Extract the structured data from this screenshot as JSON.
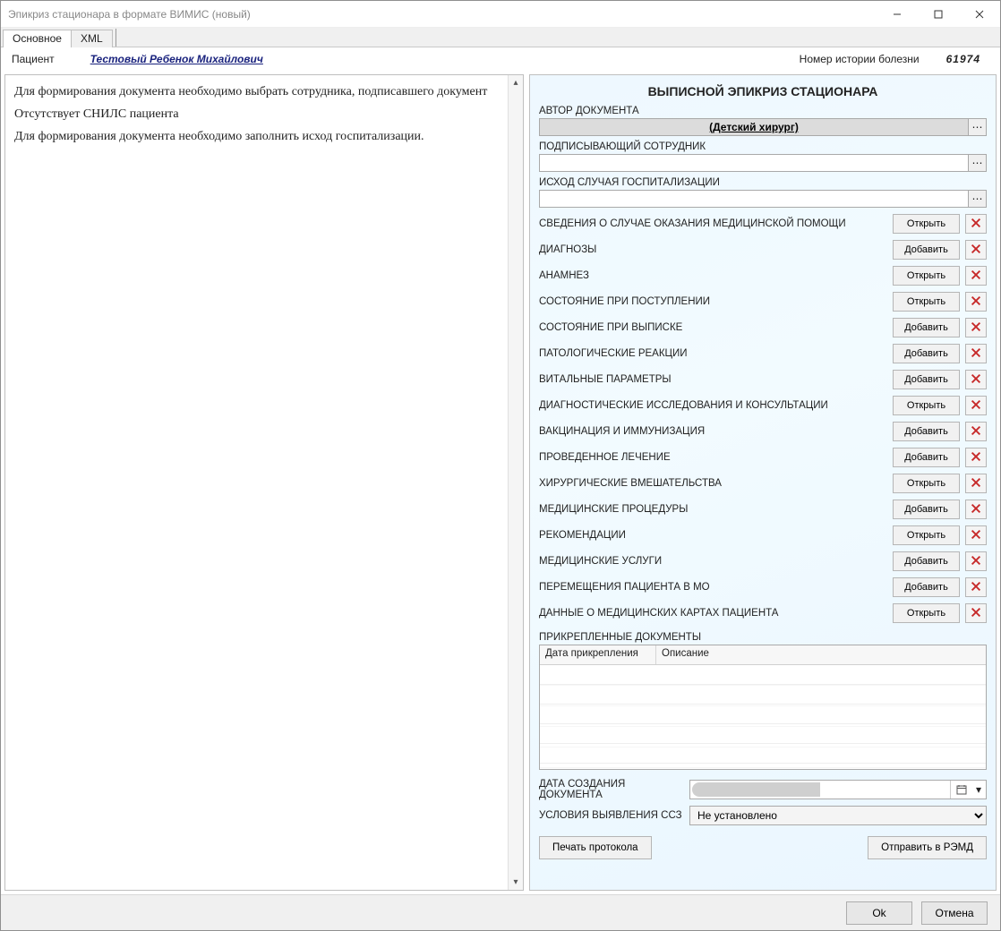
{
  "window": {
    "title": "Эпикриз стационара в формате ВИМИС (новый)"
  },
  "tabs": {
    "main": "Основное",
    "xml": "XML"
  },
  "header": {
    "patient_label": "Пациент",
    "patient_name": "Тестовый Ребенок Михайлович",
    "history_label": "Номер истории болезни",
    "history_number": "61974"
  },
  "validation": {
    "line1": "Для формирования документа необходимо выбрать сотрудника, подписавшего документ",
    "line2": "Отсутствует СНИЛС пациента",
    "line3": "Для формирования документа необходимо заполнить исход госпитализации."
  },
  "form": {
    "title": "ВЫПИСНОЙ ЭПИКРИЗ СТАЦИОНАРА",
    "author_label": "АВТОР ДОКУМЕНТА",
    "author_value": "(Детский хирург)",
    "signer_label": "ПОДПИСЫВАЮЩИЙ СОТРУДНИК",
    "signer_value": "",
    "outcome_label": "ИСХОД СЛУЧАЯ ГОСПИТАЛИЗАЦИИ",
    "outcome_value": ""
  },
  "dots": "⋯",
  "buttons": {
    "open": "Открыть",
    "add": "Добавить"
  },
  "sections": [
    {
      "name": "СВЕДЕНИЯ О СЛУЧАЕ ОКАЗАНИЯ МЕДИЦИНСКОЙ ПОМОЩИ",
      "btn": "open"
    },
    {
      "name": "ДИАГНОЗЫ",
      "btn": "add"
    },
    {
      "name": "АНАМНЕЗ",
      "btn": "open"
    },
    {
      "name": "СОСТОЯНИЕ ПРИ ПОСТУПЛЕНИИ",
      "btn": "open"
    },
    {
      "name": "СОСТОЯНИЕ ПРИ ВЫПИСКЕ",
      "btn": "add"
    },
    {
      "name": "ПАТОЛОГИЧЕСКИЕ РЕАКЦИИ",
      "btn": "add"
    },
    {
      "name": "ВИТАЛЬНЫЕ ПАРАМЕТРЫ",
      "btn": "add"
    },
    {
      "name": "ДИАГНОСТИЧЕСКИЕ ИССЛЕДОВАНИЯ И КОНСУЛЬТАЦИИ",
      "btn": "open"
    },
    {
      "name": "ВАКЦИНАЦИЯ И ИММУНИЗАЦИЯ",
      "btn": "add"
    },
    {
      "name": "ПРОВЕДЕННОЕ ЛЕЧЕНИЕ",
      "btn": "add"
    },
    {
      "name": "ХИРУРГИЧЕСКИЕ ВМЕШАТЕЛЬСТВА",
      "btn": "open"
    },
    {
      "name": "МЕДИЦИНСКИЕ ПРОЦЕДУРЫ",
      "btn": "add"
    },
    {
      "name": "РЕКОМЕНДАЦИИ",
      "btn": "open"
    },
    {
      "name": "МЕДИЦИНСКИЕ УСЛУГИ",
      "btn": "add"
    },
    {
      "name": "ПЕРЕМЕЩЕНИЯ ПАЦИЕНТА В МО",
      "btn": "add"
    },
    {
      "name": "ДАННЫЕ О МЕДИЦИНСКИХ КАРТАХ ПАЦИЕНТА",
      "btn": "open"
    }
  ],
  "attachments": {
    "label": "ПРИКРЕПЛЕННЫЕ ДОКУМЕНТЫ",
    "col_date": "Дата прикрепления",
    "col_desc": "Описание"
  },
  "date_create_label": "ДАТА СОЗДАНИЯ ДОКУМЕНТА",
  "date_create_value": " ",
  "ssz_label": "УСЛОВИЯ ВЫЯВЛЕНИЯ ССЗ",
  "ssz_value": "Не установлено",
  "bottom": {
    "print": "Печать протокола",
    "send": "Отправить в РЭМД"
  },
  "dialog": {
    "ok": "Ok",
    "cancel": "Отмена"
  }
}
